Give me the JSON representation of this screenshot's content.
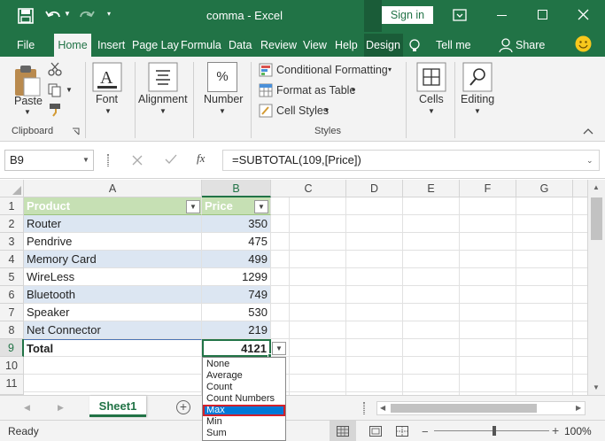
{
  "window": {
    "title": "comma  -  Excel",
    "sign_in": "Sign in",
    "accent": "#217346"
  },
  "tabs": [
    "File",
    "Home",
    "Insert",
    "Page Lay",
    "Formula",
    "Data",
    "Review",
    "View",
    "Help",
    "Design"
  ],
  "active_tab": "Home",
  "tell_me": "Tell me",
  "share": "Share",
  "ribbon": {
    "paste": "Paste",
    "clipboard": "Clipboard",
    "font": "Font",
    "alignment": "Alignment",
    "number": "Number",
    "percent_symbol": "%",
    "conditional_formatting": "Conditional Formatting",
    "format_as_table": "Format as Table",
    "cell_styles": "Cell Styles",
    "styles": "Styles",
    "cells": "Cells",
    "editing": "Editing"
  },
  "formula_bar": {
    "name_box": "B9",
    "fx": "fx",
    "formula": "=SUBTOTAL(109,[Price])"
  },
  "columns": [
    "A",
    "B",
    "C",
    "D",
    "E",
    "F",
    "G"
  ],
  "selected_column": "B",
  "rows": [
    "1",
    "2",
    "3",
    "4",
    "5",
    "6",
    "7",
    "8",
    "9",
    "10",
    "11"
  ],
  "selected_row": "9",
  "table": {
    "header": {
      "product": "Product",
      "price": "Price"
    },
    "items": [
      {
        "product": "Router",
        "price": "350"
      },
      {
        "product": "Pendrive",
        "price": "475"
      },
      {
        "product": "Memory Card",
        "price": "499"
      },
      {
        "product": "WireLess",
        "price": "1299"
      },
      {
        "product": "Bluetooth",
        "price": "749"
      },
      {
        "product": "Speaker",
        "price": "530"
      },
      {
        "product": "Net Connector",
        "price": "219"
      }
    ],
    "total_label": "Total",
    "total_value": "4121"
  },
  "dropdown": {
    "options": [
      "None",
      "Average",
      "Count",
      "Count Numbers",
      "Max",
      "Min",
      "Sum"
    ],
    "highlighted": "Max"
  },
  "sheet_tab": "Sheet1",
  "status": {
    "ready": "Ready",
    "zoom": "100%"
  }
}
